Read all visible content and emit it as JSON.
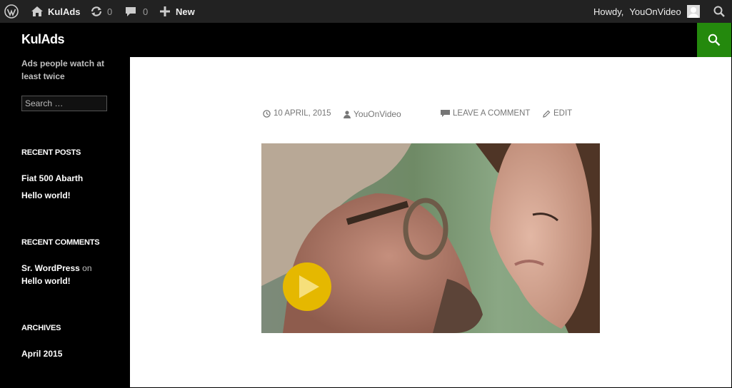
{
  "admin_bar": {
    "site_name": "KulAds",
    "updates_count": "0",
    "comments_count": "0",
    "new_label": "New",
    "howdy_label": "Howdy,",
    "user_name": "YouOnVideo"
  },
  "header": {
    "site_title": "KulAds"
  },
  "sidebar": {
    "tagline": "Ads people watch at least twice",
    "search_placeholder": "Search …",
    "recent_posts": {
      "title": "RECENT POSTS",
      "items": [
        "Fiat 500 Abarth",
        "Hello world!"
      ]
    },
    "recent_comments": {
      "title": "RECENT COMMENTS",
      "author": "Sr. WordPress",
      "on": "on",
      "post": "Hello world!"
    },
    "archives": {
      "title": "ARCHIVES",
      "items": [
        "April 2015"
      ]
    }
  },
  "post": {
    "date": "10 APRIL, 2015",
    "author": "YouOnVideo",
    "leave_comment": "LEAVE A COMMENT",
    "edit": "EDIT"
  },
  "colors": {
    "admin_bar": "#222222",
    "accent_green": "#24890d",
    "play_button": "#e5b800"
  },
  "icons": {
    "wordpress": "wordpress-logo-icon",
    "home": "home-icon",
    "updates": "refresh-icon",
    "comments": "comment-bubble-icon",
    "new": "plus-icon",
    "avatar": "avatar-icon",
    "admin_search": "search-icon",
    "header_search": "search-icon",
    "date": "clock-icon",
    "author": "person-icon",
    "comment": "comment-bubble-icon",
    "edit": "pencil-icon",
    "play": "play-icon"
  }
}
